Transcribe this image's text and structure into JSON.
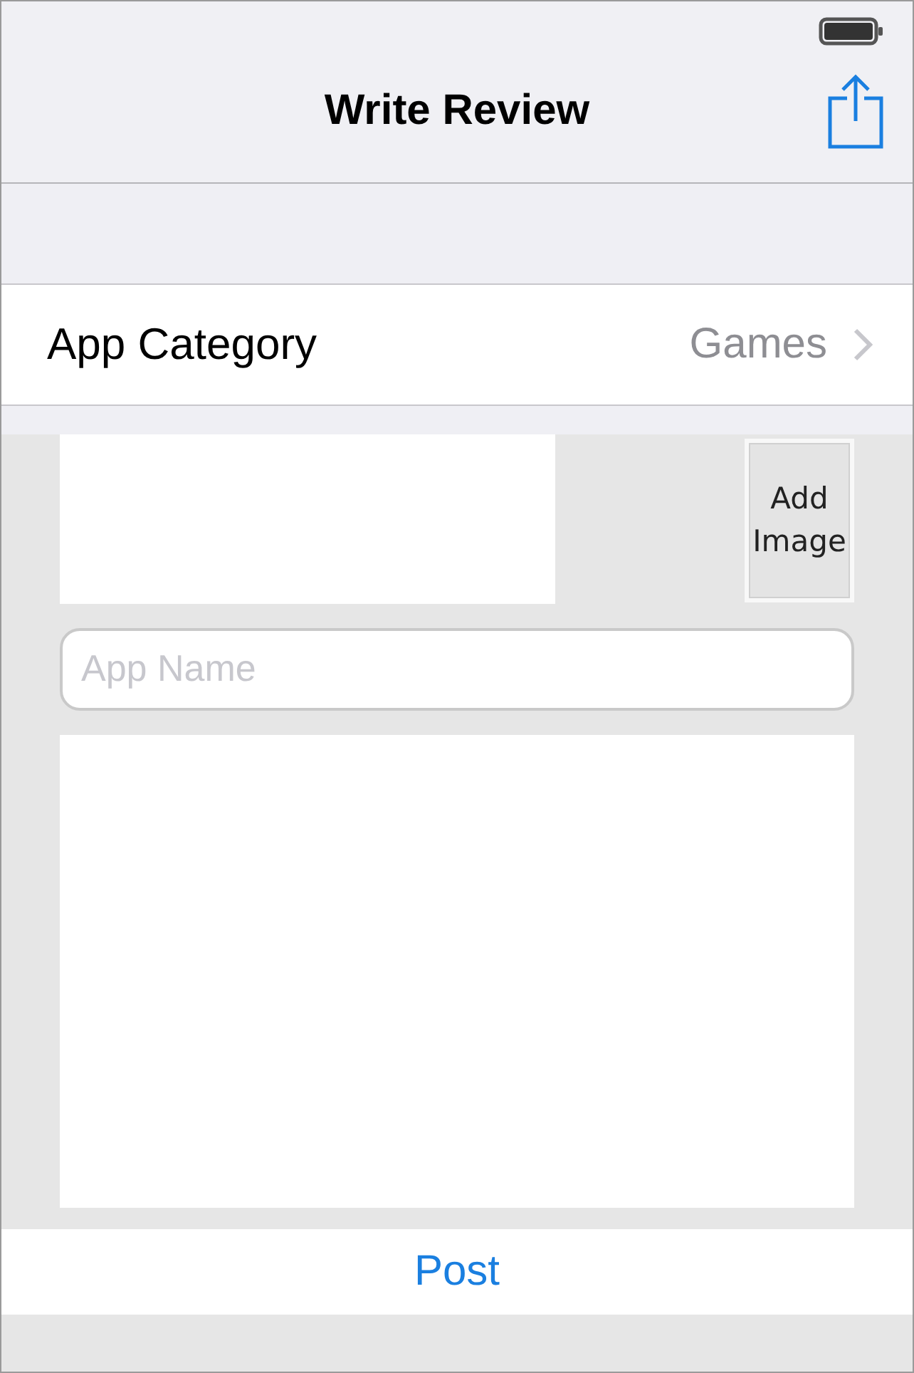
{
  "nav_bar": {
    "title": "Write Review"
  },
  "category_row": {
    "label": "App Category",
    "value": "Games"
  },
  "form": {
    "add_image_button": "Add Image",
    "app_name": {
      "placeholder": "App Name"
    }
  },
  "post_button": "Post"
}
